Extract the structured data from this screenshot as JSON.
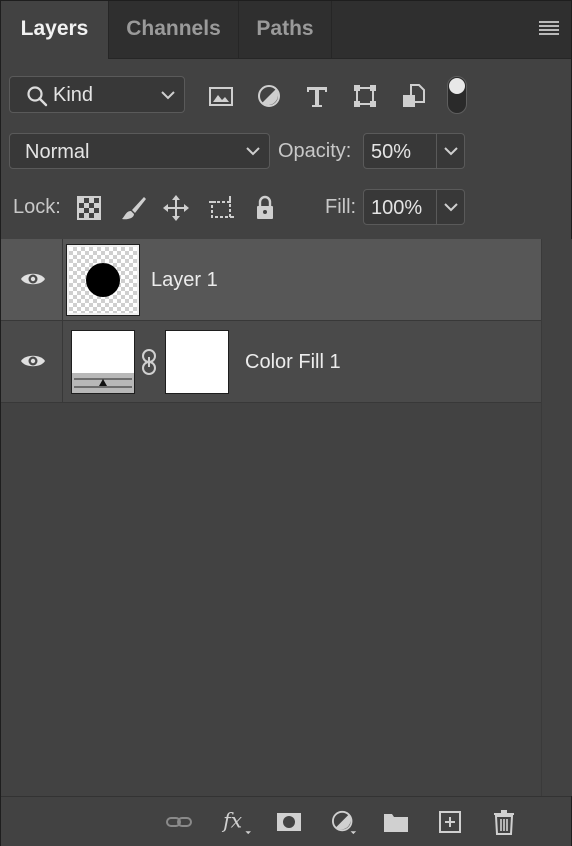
{
  "tabs": [
    {
      "label": "Layers",
      "active": true
    },
    {
      "label": "Channels",
      "active": false
    },
    {
      "label": "Paths",
      "active": false
    }
  ],
  "filter": {
    "kind_label": "Kind",
    "icons": [
      "image-filter-icon",
      "adjustment-filter-icon",
      "type-filter-icon",
      "shape-filter-icon",
      "smart-object-filter-icon"
    ],
    "filter_toggle_on": true
  },
  "blend": {
    "mode": "Normal",
    "opacity_label": "Opacity:",
    "opacity_value": "50%"
  },
  "lock": {
    "label": "Lock:",
    "fill_label": "Fill:",
    "fill_value": "100%"
  },
  "layers": [
    {
      "name": "Layer 1",
      "visible": true,
      "selected": true
    },
    {
      "name": "Color Fill 1",
      "visible": true,
      "selected": false
    }
  ],
  "colors": {
    "panel": "#424242",
    "tabbar": "#2f2f2f",
    "selected_row": "#575757",
    "row": "#4a4a4a"
  }
}
